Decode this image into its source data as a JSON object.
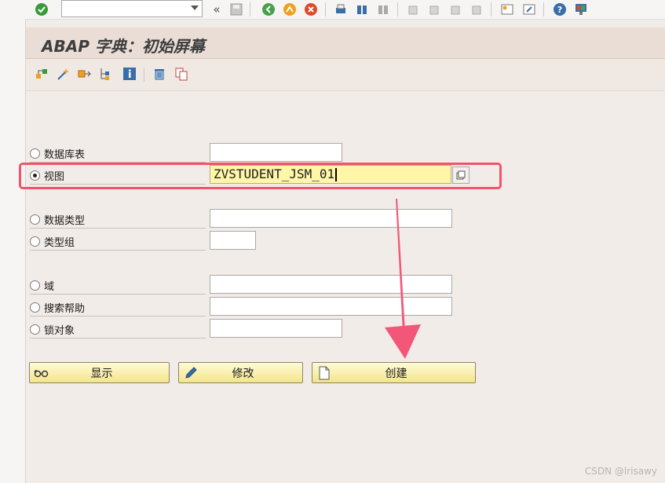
{
  "title": "ABAP 字典：初始屏幕",
  "command_field": {
    "value": ""
  },
  "options": [
    {
      "label": "数据库表",
      "selected": false,
      "value": ""
    },
    {
      "label": "视图",
      "selected": true,
      "value": "ZVSTUDENT_JSM_01"
    },
    {
      "label": "数据类型",
      "selected": false,
      "value": ""
    },
    {
      "label": "类型组",
      "selected": false,
      "value": ""
    },
    {
      "label": "域",
      "selected": false,
      "value": ""
    },
    {
      "label": "搜索帮助",
      "selected": false,
      "value": ""
    },
    {
      "label": "锁对象",
      "selected": false,
      "value": ""
    }
  ],
  "buttons": {
    "display": "显示",
    "change": "修改",
    "create": "创建"
  },
  "watermark": "CSDN @lrisawy",
  "colors": {
    "highlight": "#f0546a",
    "arrow": "#f2577a",
    "input_active": "#fff6a8"
  }
}
